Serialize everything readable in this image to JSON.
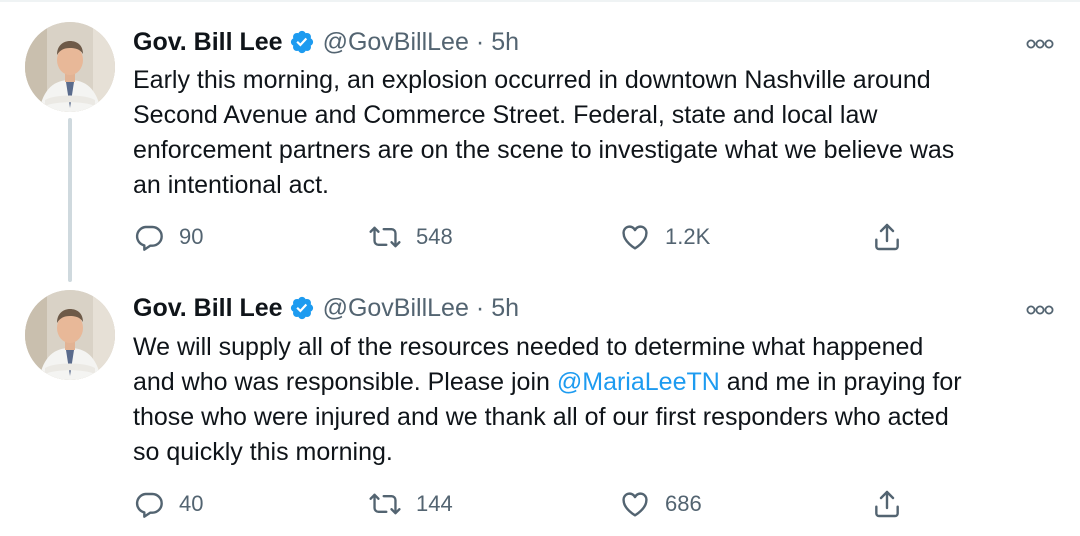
{
  "tweets": [
    {
      "author_name": "Gov. Bill Lee",
      "handle": "@GovBillLee",
      "separator": "·",
      "time": "5h",
      "text_lines": [
        "Early this morning, an explosion occurred in downtown Nashville around",
        "Second Avenue and Commerce Street. Federal, state and local law",
        "enforcement partners are on the scene to investigate what we believe was",
        "an intentional act."
      ],
      "replies": "90",
      "retweets": "548",
      "likes": "1.2K"
    },
    {
      "author_name": "Gov. Bill Lee",
      "handle": "@GovBillLee",
      "separator": "·",
      "time": "5h",
      "text_lines": [
        "We will supply all of the resources needed to determine what happened",
        "and who was responsible. Please join ",
        "@MariaLeeTN",
        " and me in praying for",
        "those who were injured and we thank all of our first responders who acted",
        "so quickly this morning."
      ],
      "replies": "40",
      "retweets": "144",
      "likes": "686"
    }
  ],
  "colors": {
    "text": "#0f1419",
    "secondary": "#536471",
    "link": "#1d9bf0",
    "verified": "#1d9bf0",
    "thread_line": "#cfd9de"
  },
  "icons": {
    "verified": "verified-badge-icon",
    "more": "more-options-icon",
    "reply": "reply-icon",
    "retweet": "retweet-icon",
    "like": "heart-icon",
    "share": "share-icon"
  }
}
